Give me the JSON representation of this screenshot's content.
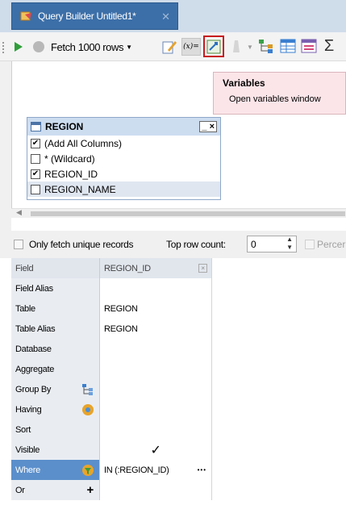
{
  "tab": {
    "title": "Query Builder Untitled1*",
    "close": "✕"
  },
  "toolbar": {
    "fetch_label": "Fetch 1000 rows",
    "var_label": "(x)=",
    "sigma": "Σ"
  },
  "tooltip": {
    "title": "Variables",
    "desc": "Open variables window"
  },
  "table_box": {
    "title": "REGION",
    "controls": "_ ×",
    "columns": [
      {
        "label": "(Add All Columns)",
        "checked": "✔"
      },
      {
        "label": "* (Wildcard)",
        "checked": ""
      },
      {
        "label": "REGION_ID",
        "checked": "✔"
      },
      {
        "label": "REGION_NAME",
        "checked": ""
      }
    ]
  },
  "options": {
    "unique_label": "Only fetch unique records",
    "top_row_label": "Top row count:",
    "top_row_value": "0",
    "percent_label": "Percer"
  },
  "grid": {
    "header": {
      "field": "Field",
      "column": "REGION_ID"
    },
    "rows": [
      {
        "label": "Field Alias",
        "value": ""
      },
      {
        "label": "Table",
        "value": "REGION"
      },
      {
        "label": "Table Alias",
        "value": "REGION"
      },
      {
        "label": "Database",
        "value": ""
      },
      {
        "label": "Aggregate",
        "value": ""
      },
      {
        "label": "Group By",
        "value": ""
      },
      {
        "label": "Having",
        "value": ""
      },
      {
        "label": "Sort",
        "value": ""
      },
      {
        "label": "Visible",
        "value": "✓"
      },
      {
        "label": "Where",
        "value": "IN (:REGION_ID)",
        "more": "•••"
      },
      {
        "label": "Or",
        "value": "",
        "plus": "+"
      }
    ]
  },
  "colors": {
    "tab": "#3c6fa8",
    "accent": "#c8191e",
    "selected_row": "#5b8fcb",
    "tooltip_bg": "#fbe5e9"
  }
}
